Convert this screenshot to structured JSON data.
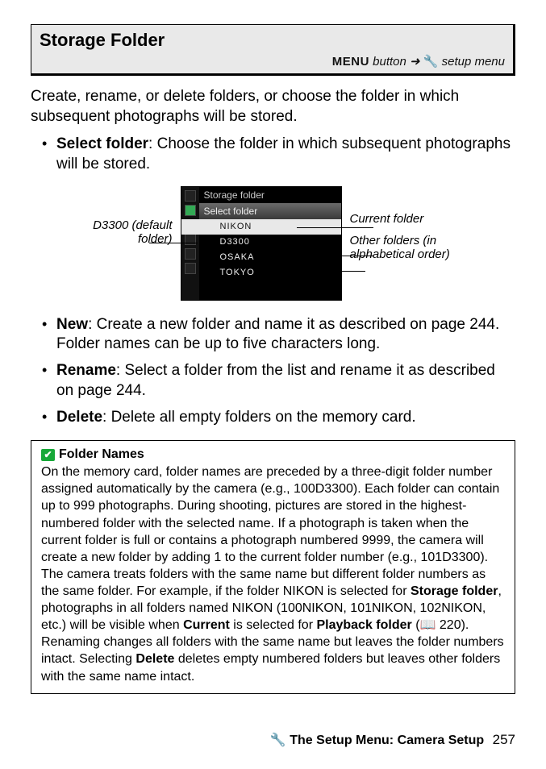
{
  "title_box": {
    "title": "Storage Folder",
    "path_menu_word": "MENU",
    "path_button_word": " button",
    "path_arrow": " ➜ ",
    "path_wrench": "🔧",
    "path_setup": " setup menu"
  },
  "intro": "Create, rename, or delete folders, or choose the folder in which subsequent photographs will be stored.",
  "bullets_top": {
    "select_label": "Select folder",
    "select_text": ": Choose the folder in which subsequent photographs will be stored."
  },
  "figure": {
    "left_callout": "D3300 (default folder)",
    "right_callout_1": "Current folder",
    "right_callout_2": "Other folders (in alphabetical order)",
    "lcd_top": "Storage folder",
    "lcd_header": "Select folder",
    "rows": [
      "NIKON",
      "D3300",
      "OSAKA",
      "TOKYO"
    ]
  },
  "bullets_bottom": [
    {
      "label": "New",
      "text": ": Create a new folder and name it as described on page 244.  Folder names can be up to five characters long."
    },
    {
      "label": "Rename",
      "text": ": Select a folder from the list and rename it as described on page 244."
    },
    {
      "label": "Delete",
      "text": ": Delete all empty folders on the memory card."
    }
  ],
  "note": {
    "title": "Folder Names",
    "body_1": "On the memory card, folder names are preceded by a three-digit folder number assigned automatically by the camera (e.g., 100D3300).  Each folder can contain up to 999 photographs.  During shooting, pictures are stored in the highest-numbered folder with the selected name.  If a photograph is taken when the current folder is full or contains a photograph numbered 9999, the camera will create a new folder by adding 1 to the current folder number (e.g., 101D3300).  The camera treats folders with the same name but different folder numbers as the same folder.  For example, if the folder NIKON is selected for ",
    "b1": "Storage folder",
    "body_2": ", photographs in all folders named NIKON (100NIKON, 101NIKON, 102NIKON, etc.) will be visible when ",
    "b2": "Current",
    "body_3": " is selected for ",
    "b3": "Playback folder",
    "body_4": " (📖 220).  Renaming changes all folders with the same name but leaves the folder numbers intact.  Selecting ",
    "b4": "Delete",
    "body_5": " deletes empty numbered folders but leaves other folders with the same name intact."
  },
  "footer": {
    "wrench": "🔧",
    "title": "The Setup Menu: Camera Setup",
    "page": "257"
  }
}
